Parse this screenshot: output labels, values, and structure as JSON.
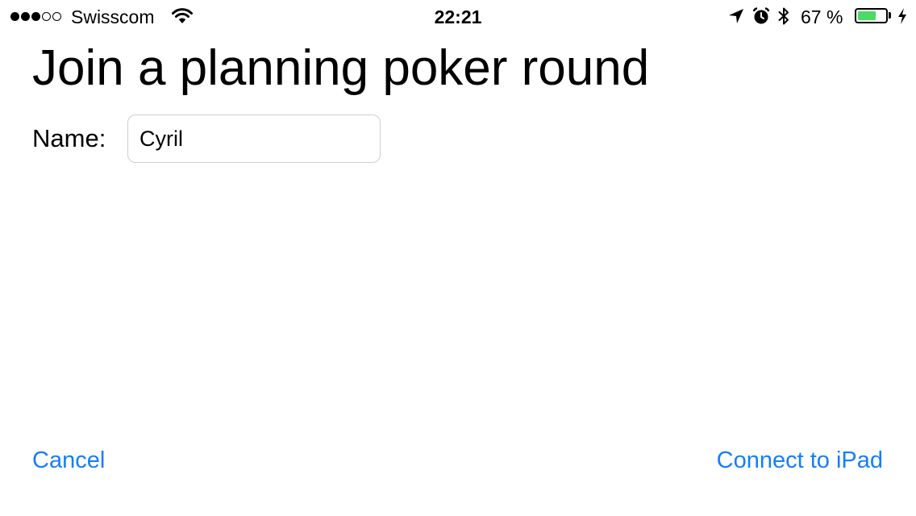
{
  "status_bar": {
    "signal_bars_total": 5,
    "signal_bars_filled": 3,
    "carrier": "Swisscom",
    "time": "22:21",
    "battery_percent_label": "67 %",
    "battery_level": 0.67,
    "icons": [
      "signal-dots-icon",
      "wifi-icon",
      "location-arrow-icon",
      "alarm-clock-icon",
      "bluetooth-icon",
      "battery-icon",
      "charging-bolt-icon"
    ]
  },
  "page": {
    "title": "Join a planning poker round"
  },
  "form": {
    "name_label": "Name:",
    "name_value": "Cyril"
  },
  "actions": {
    "cancel_label": "Cancel",
    "connect_label": "Connect to iPad"
  },
  "colors": {
    "accent": "#147EFB",
    "battery_fill": "#4CD964",
    "text": "#000000",
    "field_border": "#CFCFCF",
    "background": "#FFFFFF"
  }
}
